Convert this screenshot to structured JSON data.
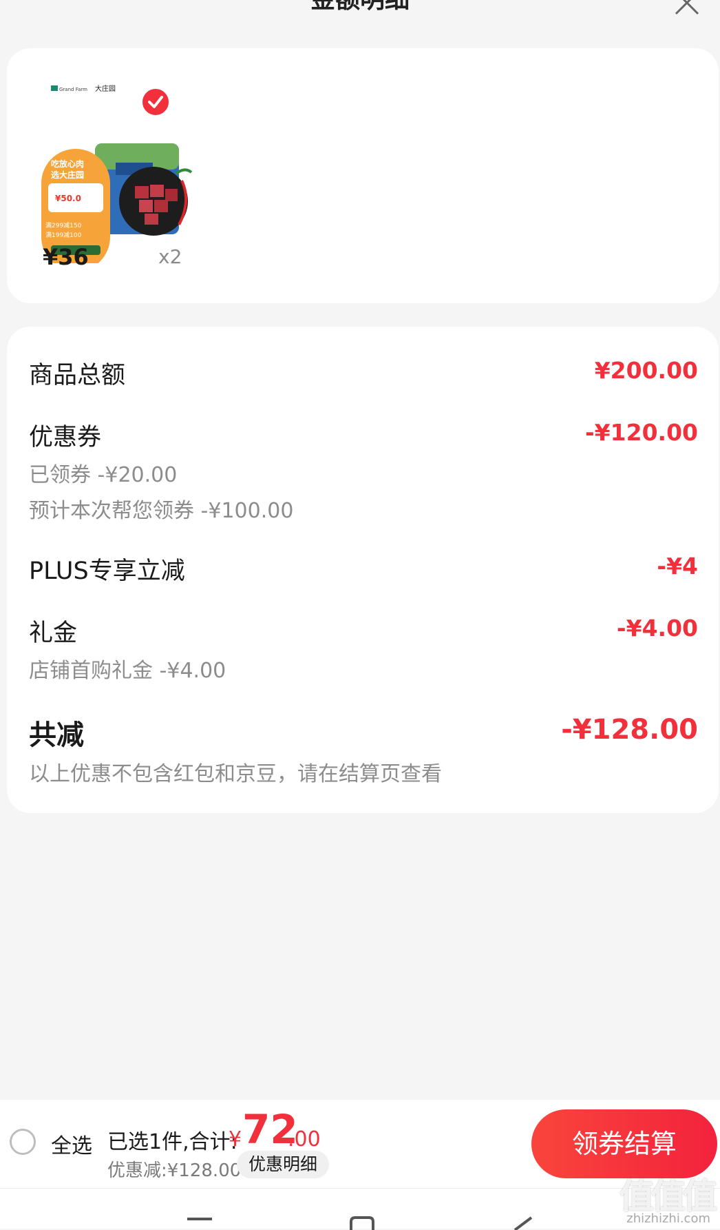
{
  "header": {
    "title": "金额明细",
    "close_icon": "close-icon"
  },
  "product": {
    "price": "¥36",
    "quantity": "x2",
    "selected": true,
    "image_brand_text": "大庄园",
    "image_badge_line1": "吃放心肉",
    "image_badge_line2": "选大庄园",
    "image_price": "¥50.0",
    "image_promo1": "满299减150",
    "image_promo2": "满199减100"
  },
  "summary": {
    "goods_total_label": "商品总额",
    "goods_total_value": "¥200.00",
    "coupon_label": "优惠券",
    "coupon_value": "-¥120.00",
    "coupon_sub1": "已领券 -¥20.00",
    "coupon_sub2": "预计本次帮您领券 -¥100.00",
    "plus_label": "PLUS专享立减",
    "plus_value": "-¥4",
    "gift_label": "礼金",
    "gift_value": "-¥4.00",
    "gift_sub": "店铺首购礼金 -¥4.00",
    "total_label": "共减",
    "total_value": "-¥128.00",
    "note": "以上优惠不包含红包和京豆，请在结算页查看"
  },
  "bottom_bar": {
    "select_all_label": "全选",
    "selected_text": "已选1件,合计:",
    "currency": "¥",
    "total_int": "72",
    "total_dec": ".00",
    "discount_text": "优惠减:¥128.00",
    "detail_button": "优惠明细",
    "checkout_button": "领券结算"
  },
  "watermark": {
    "glyphs": "值值值",
    "url": "zhizhizhi.com"
  },
  "colors": {
    "accent": "#f2303c",
    "background": "#f5f5f5",
    "card": "#ffffff",
    "muted_text": "#8c8c8c"
  }
}
